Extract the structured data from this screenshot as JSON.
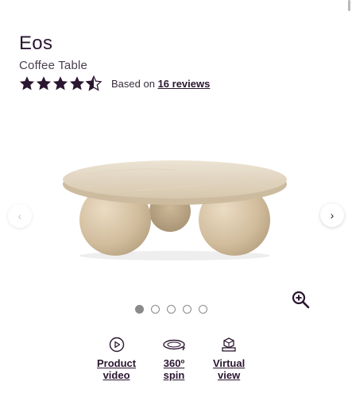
{
  "product": {
    "name": "Eos",
    "category": "Coffee Table"
  },
  "rating": {
    "value": 4.5,
    "max": 5,
    "prefix": "Based on",
    "reviews_link": "16 reviews"
  },
  "gallery": {
    "total_images": 5,
    "active_index": 0,
    "prev_icon": "chevron-left-icon",
    "next_icon": "chevron-right-icon",
    "zoom_icon": "zoom-in-icon"
  },
  "actions": [
    {
      "line1": "Product",
      "line2": "video",
      "icon": "play-circle-icon"
    },
    {
      "line1": "360º",
      "line2": "spin",
      "icon": "rotate-360-icon"
    },
    {
      "line1": "Virtual",
      "line2": "view",
      "icon": "ar-cube-icon"
    }
  ],
  "colors": {
    "brand": "#2b1630",
    "dot_active": "#8a8a8a"
  }
}
